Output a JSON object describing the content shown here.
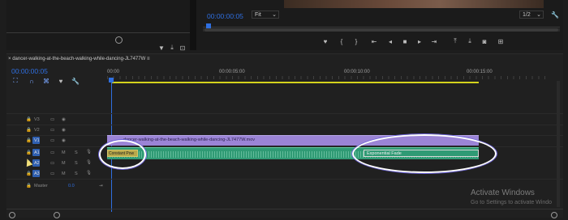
{
  "program": {
    "timecode": "00:00:00:05",
    "fit_label": "Fit",
    "resolution": "1/2"
  },
  "timeline": {
    "sequence_name": "dancer-walking-at-the-beach-walking-while-dancing-JL7477W",
    "timecode": "00:00:00:05",
    "ruler": [
      "00:00",
      "00:00:05:00",
      "00:00:10:00",
      "00:00:15:00"
    ],
    "video_tracks": [
      {
        "name": "V3"
      },
      {
        "name": "V2"
      },
      {
        "name": "V1"
      }
    ],
    "audio_tracks": [
      {
        "name": "A1",
        "m": "M",
        "s": "S"
      },
      {
        "name": "A2",
        "m": "M",
        "s": "S"
      },
      {
        "name": "A3",
        "m": "M",
        "s": "S"
      }
    ],
    "master_label": "Master",
    "master_value": "0.0",
    "video_clip_name": "dancer-walking-at-the-beach-walking-while-dancing-JL7477W.mov",
    "transitions": {
      "start": "Constant Pow",
      "end": "Exponential Fade"
    }
  },
  "watermark": {
    "title": "Activate Windows",
    "subtitle": "Go to Settings to activate Windo"
  },
  "colors": {
    "accent_blue": "#2f6fe0",
    "video_clip": "#9b84d6",
    "audio_clip": "#2f9a74",
    "work_area": "#d4d21c",
    "highlight_circle": "#ffffff"
  }
}
